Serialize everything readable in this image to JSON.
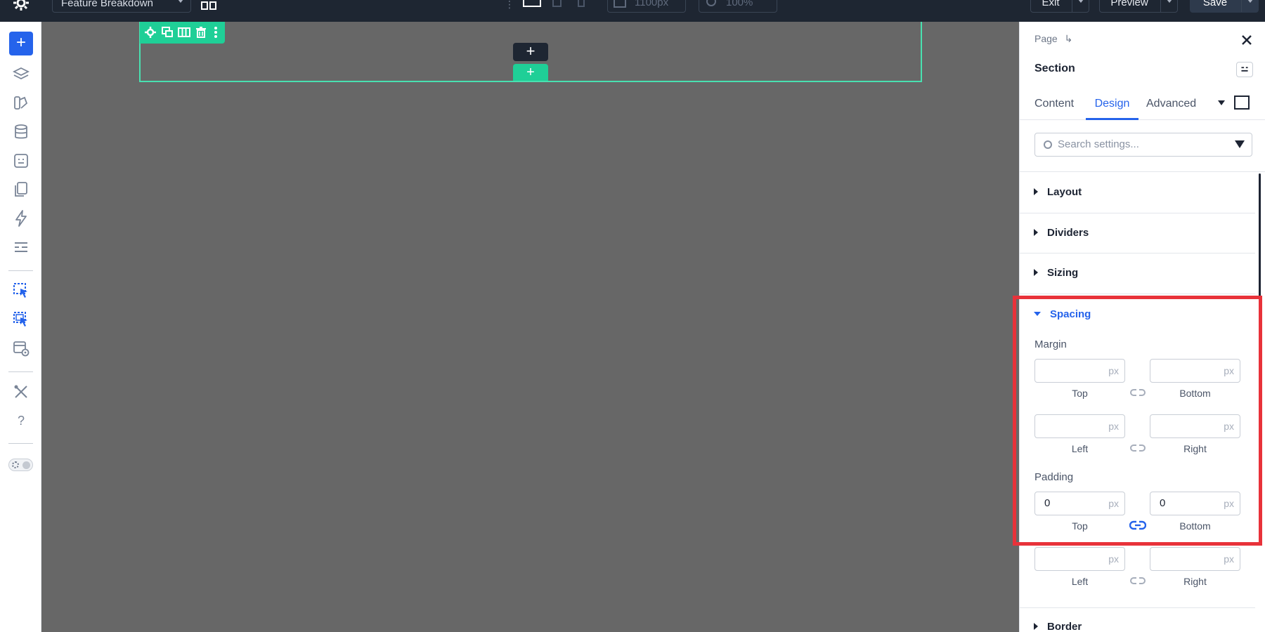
{
  "topbar": {
    "page_name": "Feature Breakdown",
    "width_value": "1100px",
    "zoom_value": "100%",
    "exit_label": "Exit",
    "preview_label": "Preview",
    "save_label": "Save"
  },
  "canvas": {
    "add_row_label": "+",
    "add_section_label": "+"
  },
  "panel": {
    "breadcrumb": "Page",
    "title": "Section",
    "tabs": [
      {
        "label": "Content"
      },
      {
        "label": "Design"
      },
      {
        "label": "Advanced"
      }
    ],
    "active_tab": "Design",
    "search_placeholder": "Search settings...",
    "groups": [
      {
        "label": "Layout"
      },
      {
        "label": "Dividers"
      },
      {
        "label": "Sizing"
      },
      {
        "label": "Spacing"
      },
      {
        "label": "Border"
      }
    ],
    "spacing": {
      "margin_label": "Margin",
      "padding_label": "Padding",
      "unit": "px",
      "margin": {
        "top": "",
        "bottom": "",
        "left": "",
        "right": ""
      },
      "padding": {
        "top": "0",
        "bottom": "0",
        "left": "",
        "right": ""
      },
      "labels": {
        "top": "Top",
        "bottom": "Bottom",
        "left": "Left",
        "right": "Right"
      }
    }
  },
  "colors": {
    "accent": "#2563eb",
    "section_green": "#1fcf97",
    "highlight_red": "#e8323a",
    "topbar_bg": "#1e2632",
    "canvas_bg": "#676767"
  }
}
